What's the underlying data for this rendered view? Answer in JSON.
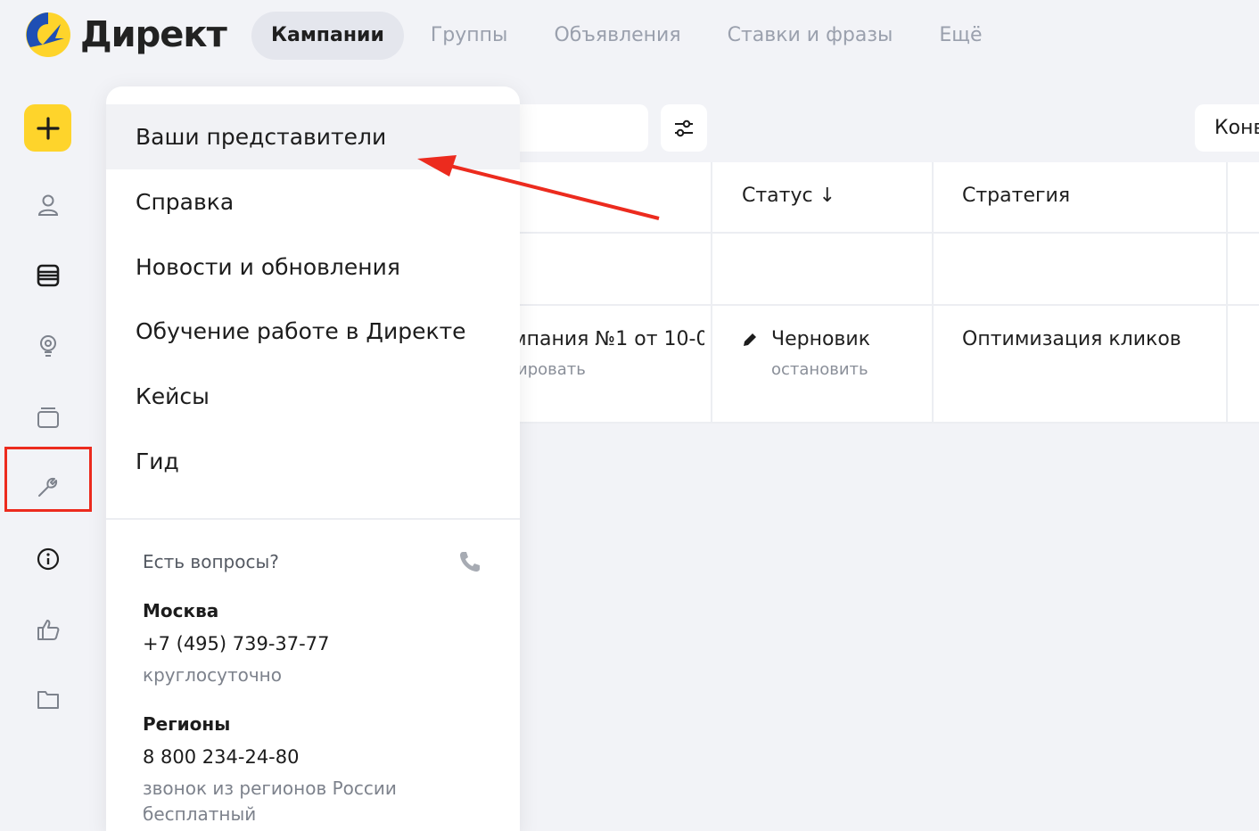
{
  "header": {
    "logo_text": "Директ",
    "tabs": [
      {
        "label": "Кампании",
        "active": true
      },
      {
        "label": "Группы",
        "active": false
      },
      {
        "label": "Объявления",
        "active": false
      },
      {
        "label": "Ставки и фразы",
        "active": false
      },
      {
        "label": "Ещё",
        "active": false
      }
    ]
  },
  "rail": {
    "add_icon": "plus-icon",
    "icons": [
      "user-icon",
      "list-icon",
      "lightbulb-icon",
      "stack-icon",
      "wrench-icon",
      "info-icon",
      "thumbs-up-icon",
      "folder-icon"
    ]
  },
  "toolbar": {
    "filter_icon": "sliders-icon",
    "convert_label": "Конв"
  },
  "table": {
    "headers": {
      "status": "Статус ↓",
      "strategy": "Стратегия"
    },
    "row": {
      "campaign_name": "мпания №1 от 10-0",
      "campaign_action": "ировать",
      "status": "Черновик",
      "status_action": "остановить",
      "strategy": "Оптимизация кликов"
    }
  },
  "menu": {
    "items": [
      "Ваши представители",
      "Справка",
      "Новости и обновления",
      "Обучение работе в Директе",
      "Кейсы",
      "Гид"
    ],
    "support": {
      "title": "Есть вопросы?",
      "moscow_city": "Москва",
      "moscow_phone": "+7 (495) 739-37-77",
      "moscow_note": "круглосуточно",
      "regions_city": "Регионы",
      "regions_phone": "8 800 234-24-80",
      "regions_note": "звонок из регионов России бесплатный"
    }
  },
  "colors": {
    "accent_yellow": "#fed42b",
    "annotation_red": "#ec2b1e",
    "logo_blue": "#1e4fb4"
  }
}
